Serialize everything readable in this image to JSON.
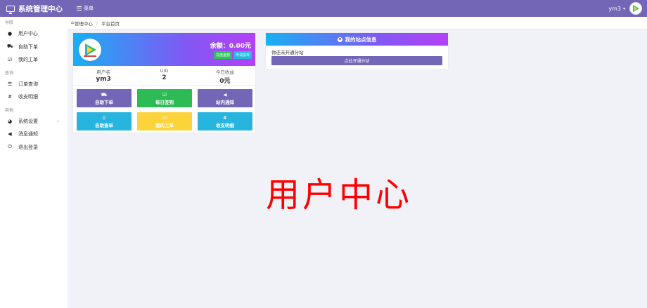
{
  "header": {
    "app_title": "系统管理中心",
    "menu_label": "菜单",
    "username": "ym3",
    "caret": "▾"
  },
  "sidebar": {
    "sections": [
      {
        "title": "导航",
        "items": [
          {
            "label": "用户中心",
            "icon": "user-icon",
            "glyph": "●"
          },
          {
            "label": "自助下单",
            "icon": "cart-icon",
            "glyph": "⛟"
          },
          {
            "label": "我的工单",
            "icon": "checkbox-icon",
            "glyph": "☑"
          }
        ]
      },
      {
        "title": "查询",
        "items": [
          {
            "label": "订单查询",
            "icon": "list-icon",
            "glyph": "☰"
          },
          {
            "label": "收支明细",
            "icon": "hash-icon",
            "glyph": "#"
          }
        ]
      },
      {
        "title": "其他",
        "items": [
          {
            "label": "系统设置",
            "icon": "dashboard-icon",
            "glyph": "◕",
            "arrow": "›"
          },
          {
            "label": "消息通知",
            "icon": "megaphone-icon",
            "glyph": "📢"
          },
          {
            "label": "退出登录",
            "icon": "power-icon",
            "glyph": "⏻"
          }
        ]
      }
    ]
  },
  "breadcrumb": {
    "home": "管理中心",
    "separator": "/",
    "current": "平台首页"
  },
  "user_card": {
    "balance": "余额：0.00元",
    "buttons": [
      "充值金额",
      "申请提现"
    ],
    "stats": [
      {
        "label": "用户名",
        "value": "ym3"
      },
      {
        "label": "UID",
        "value": "2"
      },
      {
        "label": "今日收益",
        "value": "0元"
      }
    ],
    "actions": [
      {
        "label": "自助下单",
        "icon": "cart-icon",
        "glyph": "🛒",
        "color": "#7466b6"
      },
      {
        "label": "每日签到",
        "icon": "checkbox-icon",
        "glyph": "☑",
        "color": "#2dbb55"
      },
      {
        "label": "站内通知",
        "icon": "megaphone-icon",
        "glyph": "📢",
        "color": "#7466b6"
      },
      {
        "label": "自助查单",
        "icon": "search-icon",
        "glyph": "🔍",
        "color": "#27b5e0"
      },
      {
        "label": "我的工单",
        "icon": "checkbox-icon",
        "glyph": "☑",
        "color": "#fcd33a"
      },
      {
        "label": "收支明细",
        "icon": "hash-icon",
        "glyph": "#",
        "color": "#27b5e0"
      }
    ]
  },
  "site_card": {
    "title": "我的站点信息",
    "text": "你还未开通分站",
    "button": "点此开通分站"
  },
  "watermark": "用户中心",
  "colors": {
    "accent": "#7466b6",
    "gradient_start": "#18b0f3",
    "gradient_end": "#b53ff7",
    "watermark": "#ff0000"
  }
}
